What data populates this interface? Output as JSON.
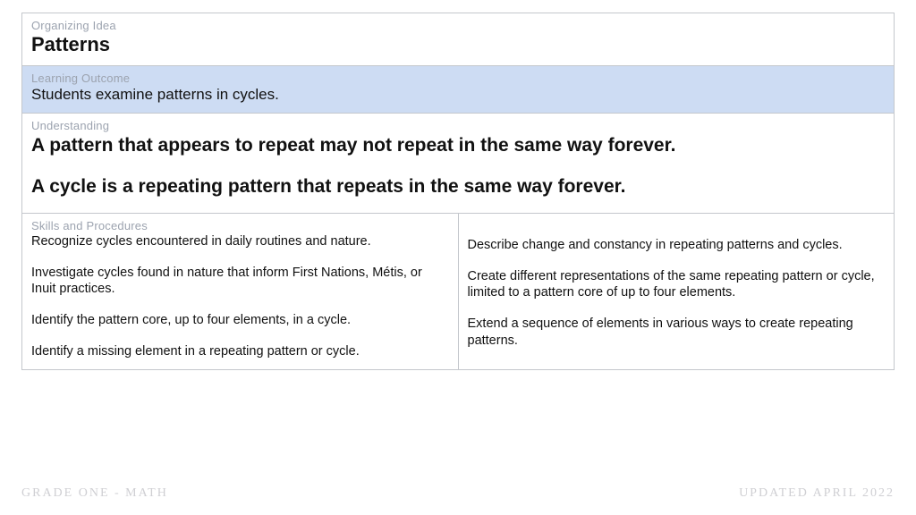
{
  "organizing": {
    "label": "Organizing Idea",
    "title": "Patterns"
  },
  "outcome": {
    "label": "Learning Outcome",
    "text": "Students examine patterns in cycles."
  },
  "understanding": {
    "label": "Understanding",
    "line1": "A pattern that appears to repeat may not repeat in the same way forever.",
    "line2": "A cycle is a repeating pattern that repeats in the same way forever."
  },
  "skills": {
    "label": "Skills and Procedures",
    "left": [
      "Recognize cycles encountered in daily routines and nature.",
      "Investigate cycles found in nature that inform First Nations, Métis, or Inuit practices.",
      "Identify the pattern core, up to four elements, in a cycle.",
      "Identify a missing element in a repeating pattern or cycle."
    ],
    "right": [
      "Describe change and constancy in repeating patterns and cycles.",
      "Create different representations of the same repeating pattern or cycle, limited to a pattern core of up to four elements.",
      "Extend a sequence of elements in various ways to create repeating patterns."
    ]
  },
  "footer": {
    "left": "GRADE ONE - MATH",
    "right": "UPDATED APRIL 2022"
  }
}
